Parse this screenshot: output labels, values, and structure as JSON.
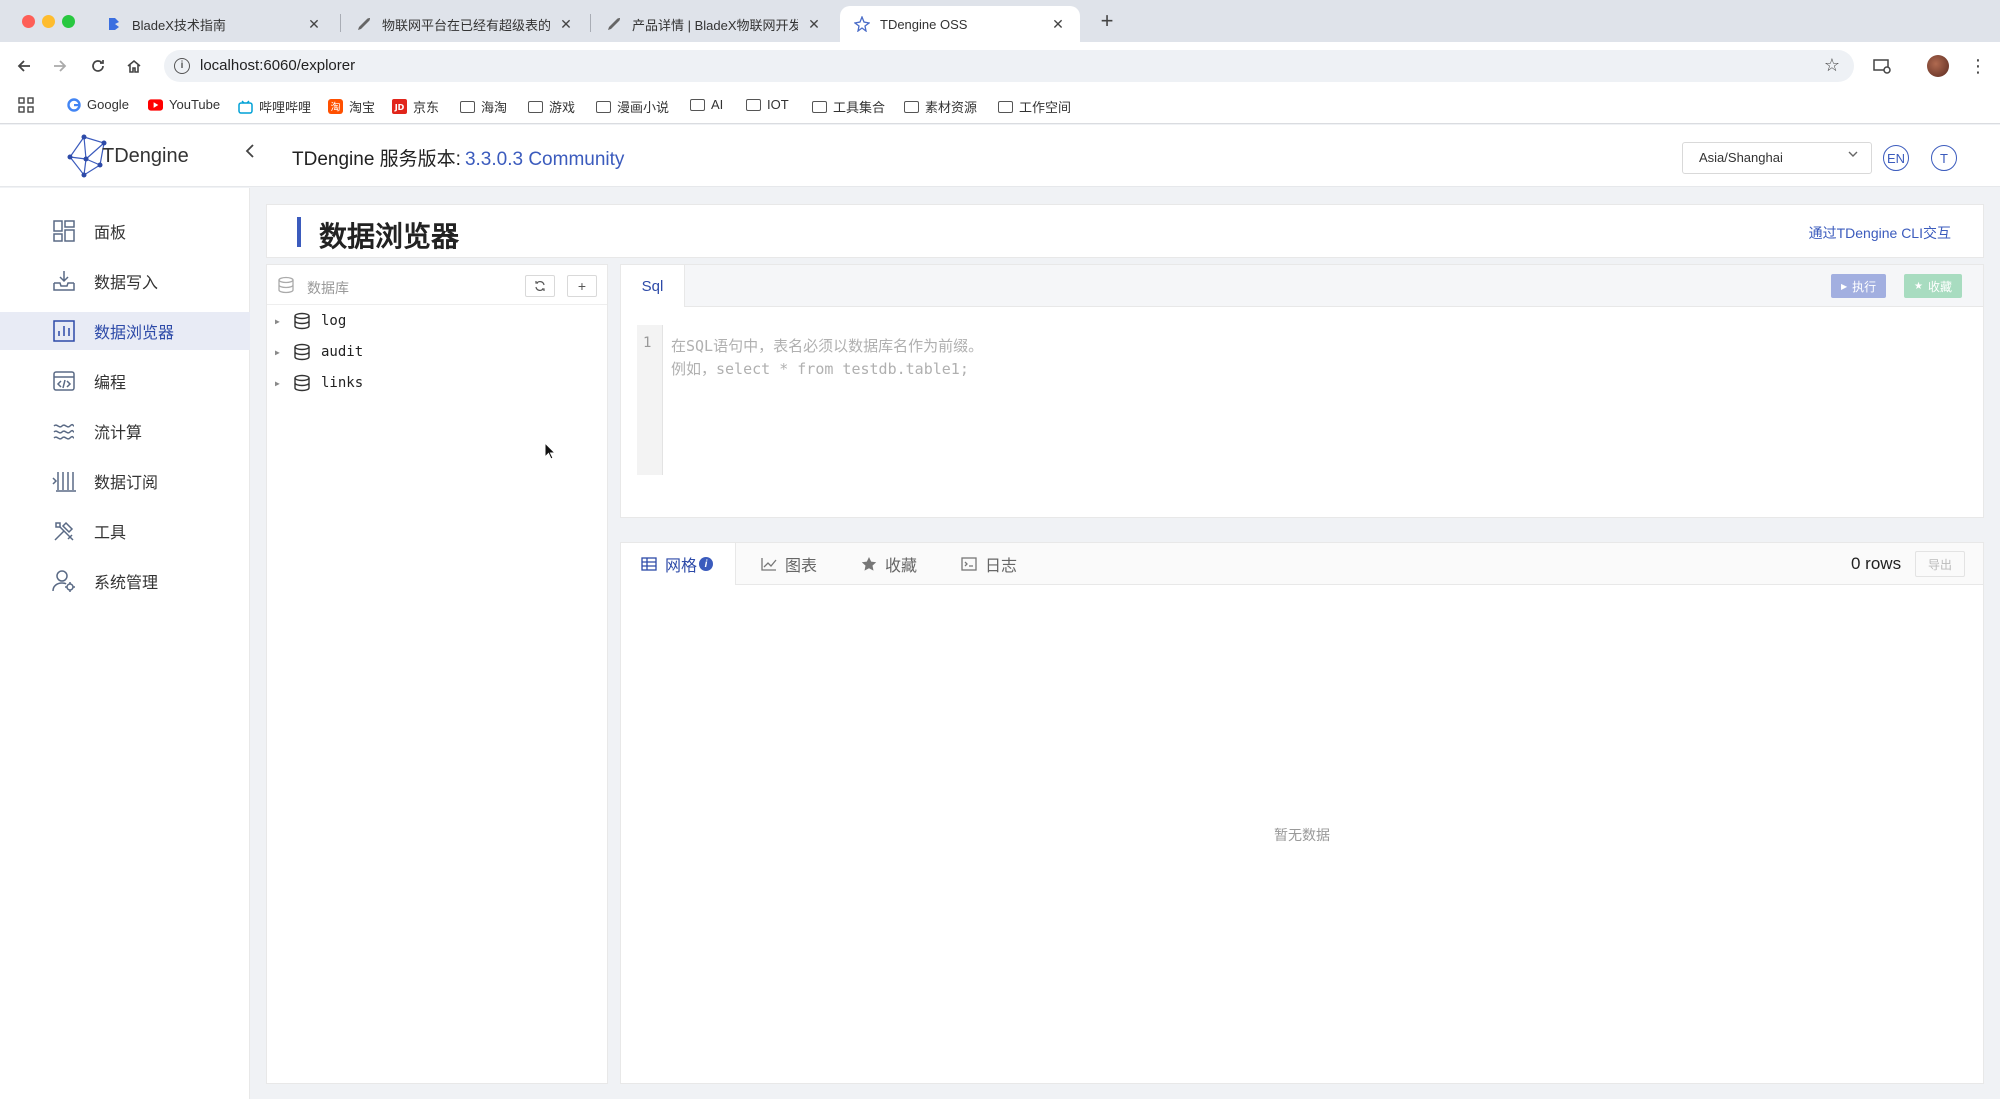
{
  "browser": {
    "tabs": [
      {
        "title": "BladeX技术指南",
        "favicon": "bladex-icon"
      },
      {
        "title": "物联网平台在已经有超级表的情",
        "favicon": "rocket-icon"
      },
      {
        "title": "产品详情 | BladeX物联网开发平",
        "favicon": "rocket-icon"
      },
      {
        "title": "TDengine OSS",
        "favicon": "tdengine-icon"
      }
    ],
    "url": "localhost:6060/explorer",
    "bookmarks": [
      {
        "label": "Google"
      },
      {
        "label": "YouTube"
      },
      {
        "label": "哔哩哔哩"
      },
      {
        "label": "淘宝"
      },
      {
        "label": "京东"
      },
      {
        "label": "海淘"
      },
      {
        "label": "游戏"
      },
      {
        "label": "漫画小说"
      },
      {
        "label": "AI"
      },
      {
        "label": "IOT"
      },
      {
        "label": "工具集合"
      },
      {
        "label": "素材资源"
      },
      {
        "label": "工作空间"
      }
    ]
  },
  "header": {
    "logo_text": "TDengine",
    "service_label": "TDengine 服务版本:",
    "service_version": "3.3.0.3 Community",
    "timezone": "Asia/Shanghai",
    "lang_button": "EN",
    "user_button": "T"
  },
  "sidebar": {
    "items": [
      {
        "label": "面板",
        "icon": "dashboard-icon"
      },
      {
        "label": "数据写入",
        "icon": "data-in-icon"
      },
      {
        "label": "数据浏览器",
        "icon": "explorer-icon",
        "active": true
      },
      {
        "label": "编程",
        "icon": "code-icon"
      },
      {
        "label": "流计算",
        "icon": "stream-icon"
      },
      {
        "label": "数据订阅",
        "icon": "subscribe-icon"
      },
      {
        "label": "工具",
        "icon": "tools-icon"
      },
      {
        "label": "系统管理",
        "icon": "admin-icon"
      }
    ]
  },
  "page": {
    "title": "数据浏览器",
    "cli_link": "通过TDengine CLI交互"
  },
  "db_panel": {
    "header": "数据库",
    "databases": [
      "log",
      "audit",
      "links"
    ]
  },
  "sql": {
    "tab": "Sql",
    "exec_label": "执行",
    "fav_label": "收藏",
    "line_number": "1",
    "placeholder_line1": "在SQL语句中，表名必须以数据库名作为前缀。",
    "placeholder_line2": "例如，select * from testdb.table1;"
  },
  "results": {
    "tabs": [
      "网格",
      "图表",
      "收藏",
      "日志"
    ],
    "rows": "0 rows",
    "export_label": "导出",
    "empty_text": "暂无数据"
  },
  "colors": {
    "accent": "#3b5bbd",
    "active_menu_bg": "#e8ebf5"
  }
}
